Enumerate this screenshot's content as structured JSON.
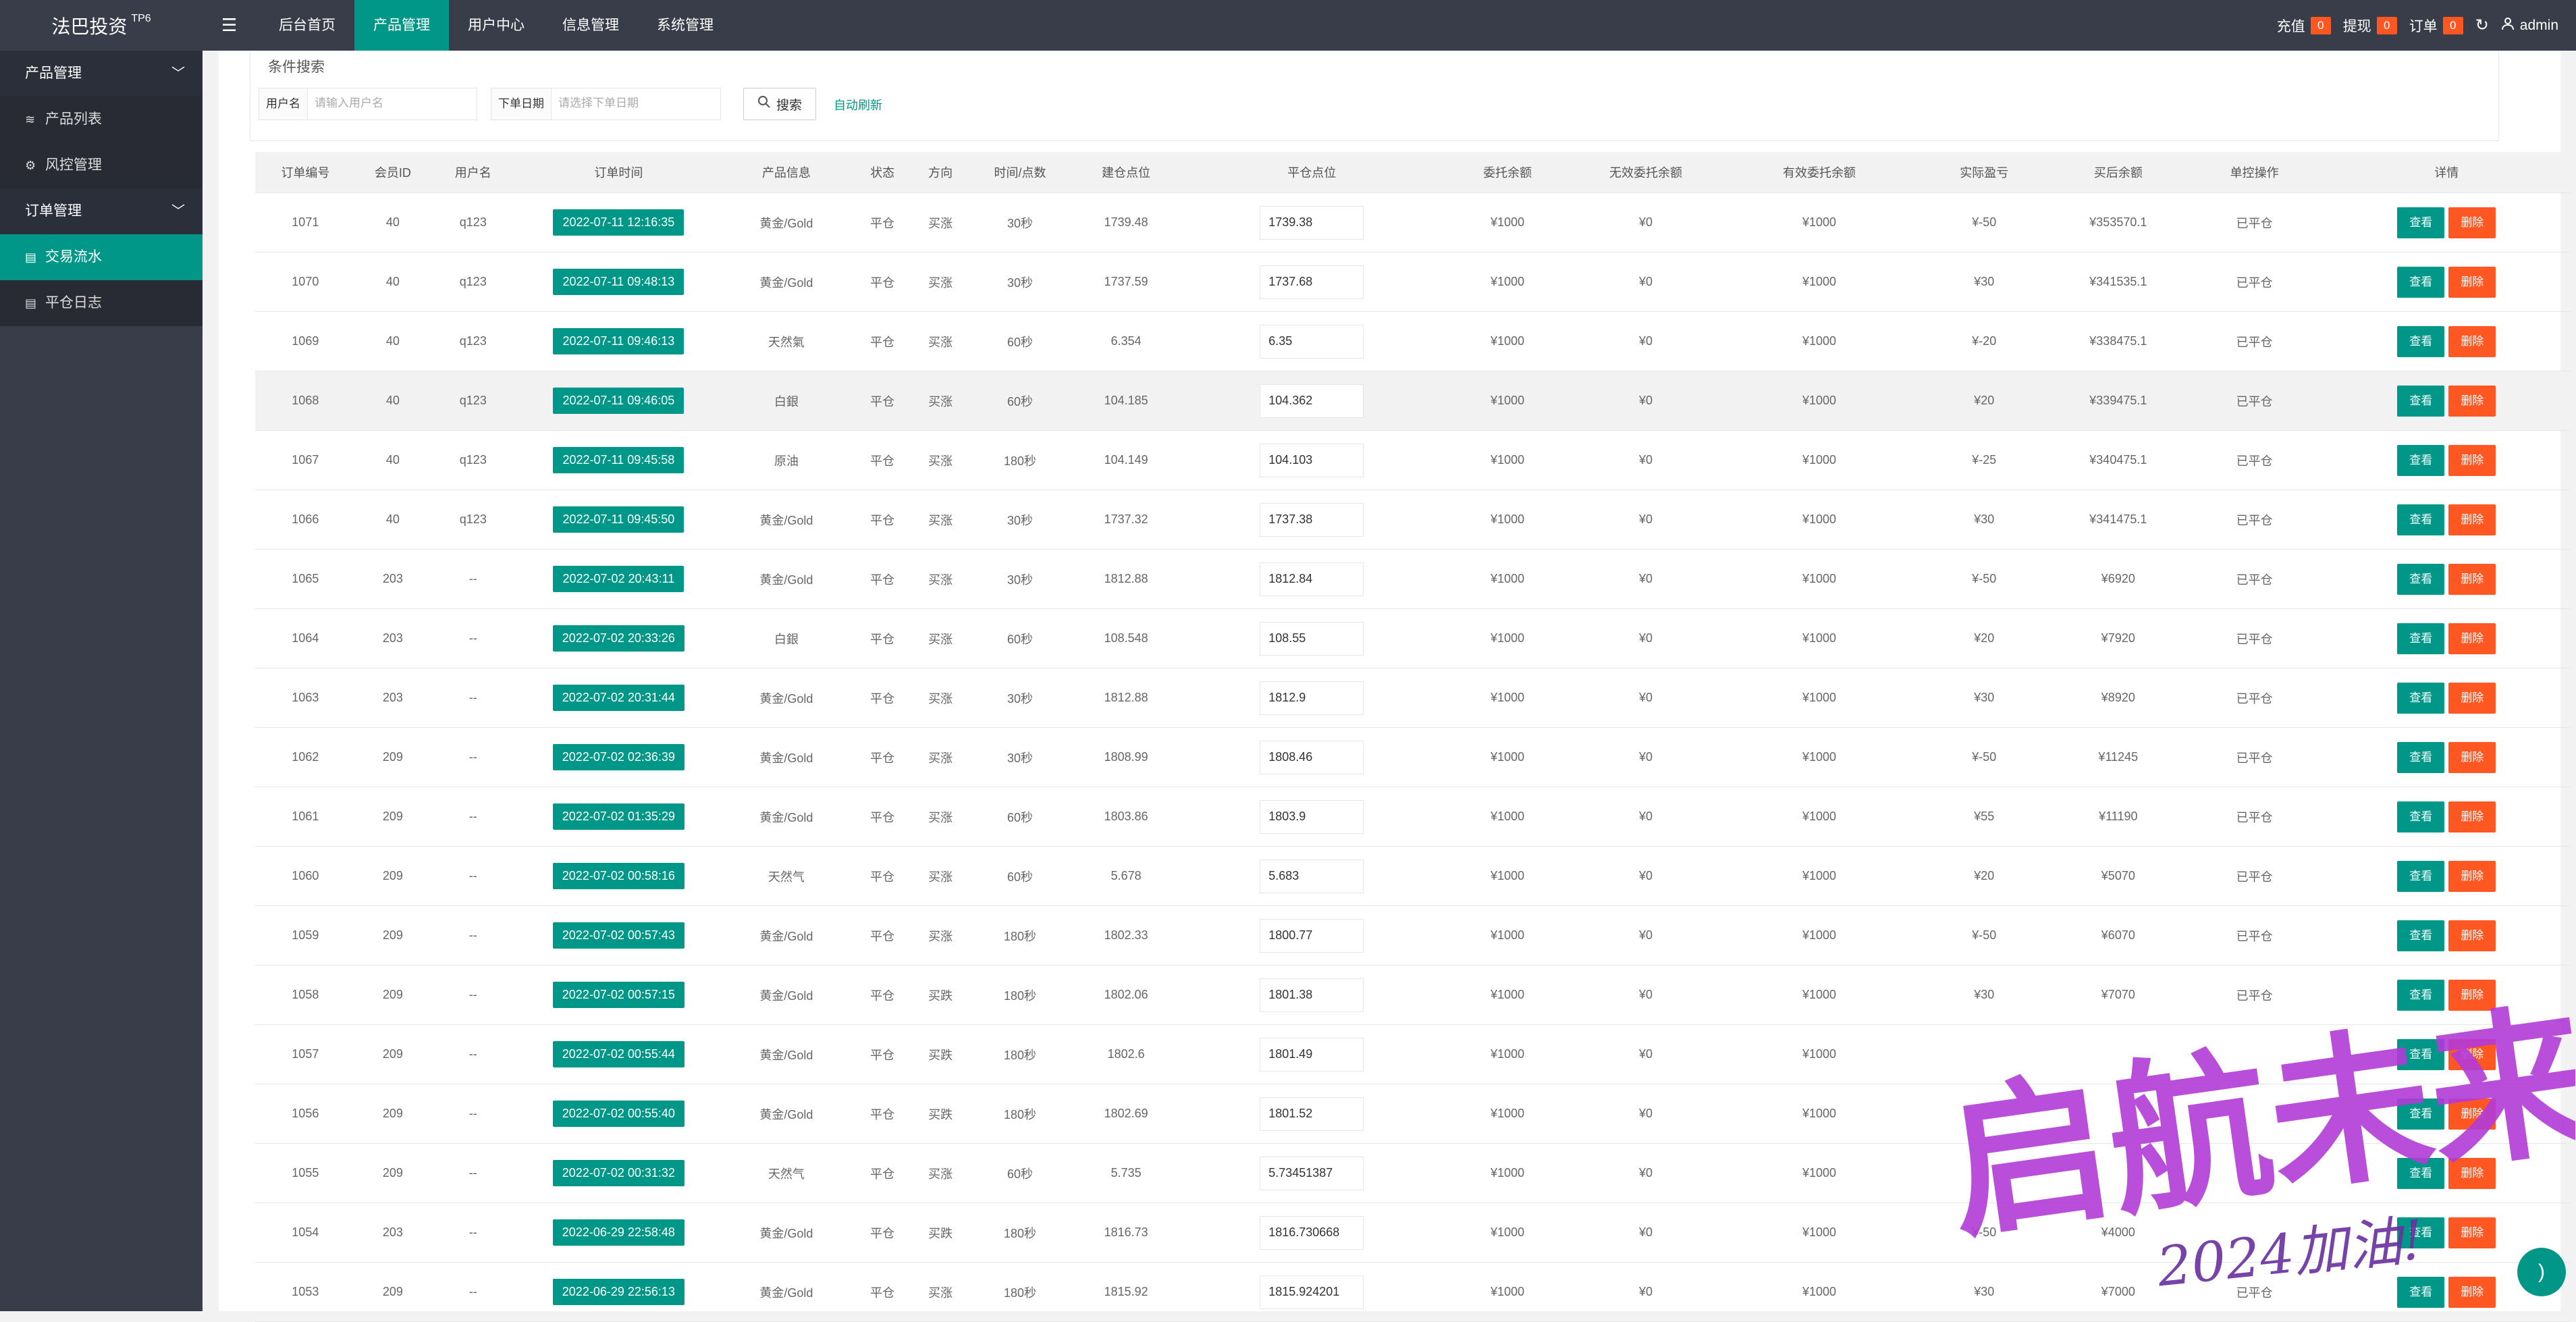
{
  "header": {
    "logo": "法巴投资",
    "logo_sup": "TP6",
    "nav": [
      "后台首页",
      "产品管理",
      "用户中心",
      "信息管理",
      "系统管理"
    ],
    "active_index": 1,
    "recharge_label": "充值",
    "recharge_count": "0",
    "withdraw_label": "提现",
    "withdraw_count": "0",
    "order_label": "订单",
    "order_count": "0",
    "user": "admin"
  },
  "sidebar": {
    "group1": "产品管理",
    "item_product_list": "产品列表",
    "item_risk": "风控管理",
    "group2": "订单管理",
    "item_trade_flow": "交易流水",
    "item_close_log": "平仓日志"
  },
  "search": {
    "legend": "条件搜索",
    "username_label": "用户名",
    "username_placeholder": "请输入用户名",
    "date_label": "下单日期",
    "date_placeholder": "请选择下单日期",
    "search_button": "搜索",
    "auto_refresh": "自动刷新"
  },
  "table": {
    "headers": [
      "订单编号",
      "会员ID",
      "用户名",
      "订单时间",
      "产品信息",
      "状态",
      "方向",
      "时间/点数",
      "建仓点位",
      "平仓点位",
      "委托余额",
      "无效委托余额",
      "有效委托余额",
      "实际盈亏",
      "买后余额",
      "单控操作",
      "详情"
    ],
    "view_label": "查看",
    "delete_label": "删除",
    "rows": [
      [
        "1071",
        "40",
        "q123",
        "2022-07-11 12:16:35",
        "黄金/Gold",
        "平仓",
        "买涨",
        "30秒",
        "1739.48",
        "1739.38",
        "¥1000",
        "¥0",
        "¥1000",
        "¥-50",
        "¥353570.1",
        "已平仓"
      ],
      [
        "1070",
        "40",
        "q123",
        "2022-07-11 09:48:13",
        "黄金/Gold",
        "平仓",
        "买涨",
        "30秒",
        "1737.59",
        "1737.68",
        "¥1000",
        "¥0",
        "¥1000",
        "¥30",
        "¥341535.1",
        "已平仓"
      ],
      [
        "1069",
        "40",
        "q123",
        "2022-07-11 09:46:13",
        "天然氣",
        "平仓",
        "买涨",
        "60秒",
        "6.354",
        "6.35",
        "¥1000",
        "¥0",
        "¥1000",
        "¥-20",
        "¥338475.1",
        "已平仓"
      ],
      [
        "1068",
        "40",
        "q123",
        "2022-07-11 09:46:05",
        "白銀",
        "平仓",
        "买涨",
        "60秒",
        "104.185",
        "104.362",
        "¥1000",
        "¥0",
        "¥1000",
        "¥20",
        "¥339475.1",
        "已平仓"
      ],
      [
        "1067",
        "40",
        "q123",
        "2022-07-11 09:45:58",
        "原油",
        "平仓",
        "买涨",
        "180秒",
        "104.149",
        "104.103",
        "¥1000",
        "¥0",
        "¥1000",
        "¥-25",
        "¥340475.1",
        "已平仓"
      ],
      [
        "1066",
        "40",
        "q123",
        "2022-07-11 09:45:50",
        "黄金/Gold",
        "平仓",
        "买涨",
        "30秒",
        "1737.32",
        "1737.38",
        "¥1000",
        "¥0",
        "¥1000",
        "¥30",
        "¥341475.1",
        "已平仓"
      ],
      [
        "1065",
        "203",
        "--",
        "2022-07-02 20:43:11",
        "黄金/Gold",
        "平仓",
        "买涨",
        "30秒",
        "1812.88",
        "1812.84",
        "¥1000",
        "¥0",
        "¥1000",
        "¥-50",
        "¥6920",
        "已平仓"
      ],
      [
        "1064",
        "203",
        "--",
        "2022-07-02 20:33:26",
        "白銀",
        "平仓",
        "买涨",
        "60秒",
        "108.548",
        "108.55",
        "¥1000",
        "¥0",
        "¥1000",
        "¥20",
        "¥7920",
        "已平仓"
      ],
      [
        "1063",
        "203",
        "--",
        "2022-07-02 20:31:44",
        "黄金/Gold",
        "平仓",
        "买涨",
        "30秒",
        "1812.88",
        "1812.9",
        "¥1000",
        "¥0",
        "¥1000",
        "¥30",
        "¥8920",
        "已平仓"
      ],
      [
        "1062",
        "209",
        "--",
        "2022-07-02 02:36:39",
        "黄金/Gold",
        "平仓",
        "买涨",
        "30秒",
        "1808.99",
        "1808.46",
        "¥1000",
        "¥0",
        "¥1000",
        "¥-50",
        "¥11245",
        "已平仓"
      ],
      [
        "1061",
        "209",
        "--",
        "2022-07-02 01:35:29",
        "黄金/Gold",
        "平仓",
        "买涨",
        "60秒",
        "1803.86",
        "1803.9",
        "¥1000",
        "¥0",
        "¥1000",
        "¥55",
        "¥11190",
        "已平仓"
      ],
      [
        "1060",
        "209",
        "--",
        "2022-07-02 00:58:16",
        "天然气",
        "平仓",
        "买涨",
        "60秒",
        "5.678",
        "5.683",
        "¥1000",
        "¥0",
        "¥1000",
        "¥20",
        "¥5070",
        "已平仓"
      ],
      [
        "1059",
        "209",
        "--",
        "2022-07-02 00:57:43",
        "黄金/Gold",
        "平仓",
        "买涨",
        "180秒",
        "1802.33",
        "1800.77",
        "¥1000",
        "¥0",
        "¥1000",
        "¥-50",
        "¥6070",
        "已平仓"
      ],
      [
        "1058",
        "209",
        "--",
        "2022-07-02 00:57:15",
        "黄金/Gold",
        "平仓",
        "买跌",
        "180秒",
        "1802.06",
        "1801.38",
        "¥1000",
        "¥0",
        "¥1000",
        "¥30",
        "¥7070",
        "已平仓"
      ],
      [
        "1057",
        "209",
        "--",
        "2022-07-02 00:55:44",
        "黄金/Gold",
        "平仓",
        "买跌",
        "180秒",
        "1802.6",
        "1801.49",
        "¥1000",
        "¥0",
        "¥1000",
        "",
        "",
        ""
      ],
      [
        "1056",
        "209",
        "--",
        "2022-07-02 00:55:40",
        "黄金/Gold",
        "平仓",
        "买跌",
        "180秒",
        "1802.69",
        "1801.52",
        "¥1000",
        "¥0",
        "¥1000",
        "",
        "",
        ""
      ],
      [
        "1055",
        "209",
        "--",
        "2022-07-02 00:31:32",
        "天然气",
        "平仓",
        "买涨",
        "60秒",
        "5.735",
        "5.73451387",
        "¥1000",
        "¥0",
        "¥1000",
        "",
        "",
        ""
      ],
      [
        "1054",
        "203",
        "--",
        "2022-06-29 22:58:48",
        "黄金/Gold",
        "平仓",
        "买跌",
        "180秒",
        "1816.73",
        "1816.730668",
        "¥1000",
        "¥0",
        "¥1000",
        "¥-50",
        "¥4000",
        ""
      ],
      [
        "1053",
        "209",
        "--",
        "2022-06-29 22:56:13",
        "黄金/Gold",
        "平仓",
        "买涨",
        "180秒",
        "1815.92",
        "1815.924201",
        "¥1000",
        "¥0",
        "¥1000",
        "¥30",
        "¥7000",
        "已平仓"
      ]
    ]
  },
  "watermark": {
    "main": "启航未来",
    "sub": "2024加油!"
  },
  "colors": {
    "accent": "#009688",
    "danger": "#ff5722",
    "header_bg": "#393d49",
    "profit_red": "#ff2222",
    "loss_green": "#1a9a1a",
    "watermark": "#b23bd8"
  }
}
